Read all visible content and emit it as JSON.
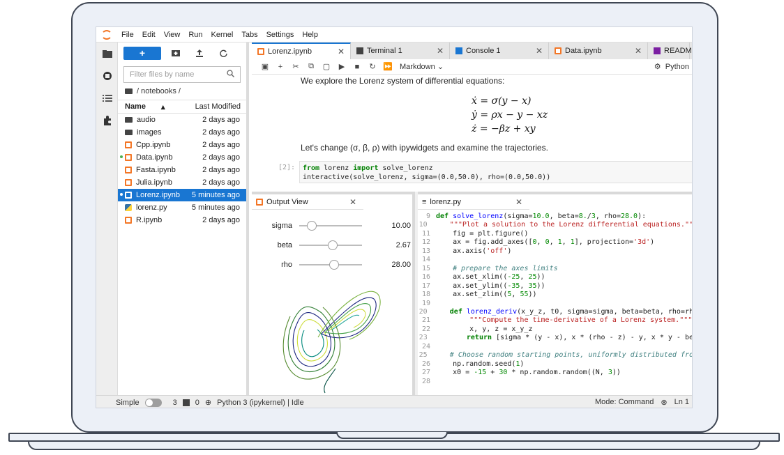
{
  "menu": [
    "File",
    "Edit",
    "View",
    "Run",
    "Kernel",
    "Tabs",
    "Settings",
    "Help"
  ],
  "filebrowser": {
    "search_placeholder": "Filter files by name",
    "breadcrumb": "/ notebooks /",
    "col_name": "Name",
    "col_modified": "Last Modified",
    "files": [
      {
        "name": "audio",
        "modified": "2 days ago"
      },
      {
        "name": "images",
        "modified": "2 days ago"
      },
      {
        "name": "Cpp.ipynb",
        "modified": "2 days ago"
      },
      {
        "name": "Data.ipynb",
        "modified": "2 days ago"
      },
      {
        "name": "Fasta.ipynb",
        "modified": "2 days ago"
      },
      {
        "name": "Julia.ipynb",
        "modified": "2 days ago"
      },
      {
        "name": "Lorenz.ipynb",
        "modified": "5 minutes ago"
      },
      {
        "name": "lorenz.py",
        "modified": "5 minutes ago"
      },
      {
        "name": "R.ipynb",
        "modified": "2 days ago"
      }
    ]
  },
  "tabs": [
    "Lorenz.ipynb",
    "Terminal 1",
    "Console 1",
    "Data.ipynb",
    "README"
  ],
  "nb_toolbar": {
    "celltype": "Markdown",
    "kernel": "Python"
  },
  "notebook": {
    "intro": "We explore the Lorenz system of differential equations:",
    "eq1": "ẋ = σ(y − x)",
    "eq2": "ẏ = ρx − y − xz",
    "eq3": "ż = −βz + xy",
    "change": "Let's change (σ, β, ρ) with ipywidgets and examine the trajectories.",
    "prompt": "[2]:",
    "code1_kw1": "from",
    "code1_mid": " lorenz ",
    "code1_kw2": "import",
    "code1_end": " solve_lorenz",
    "code2": "interactive(solve_lorenz, sigma=(0.0,50.0), rho=(0.0,50.0))"
  },
  "output_view": {
    "title": "Output View",
    "sliders": [
      {
        "label": "sigma",
        "value": "10.00",
        "fraction": 0.2
      },
      {
        "label": "beta",
        "value": "2.67",
        "fraction": 0.53
      },
      {
        "label": "rho",
        "value": "28.00",
        "fraction": 0.56
      }
    ]
  },
  "editor": {
    "title": "lorenz.py",
    "lines": [
      {
        "n": "9",
        "html": "<span class='kwb'>def</span> <span class='fn'>solve_lorenz</span>(sigma=<span class='nm'>10.0</span>, beta=<span class='nm'>8.</span>/<span class='nm'>3</span>, rho=<span class='nm'>28.0</span>):"
      },
      {
        "n": "10",
        "html": "    <span class='str'>\"\"\"Plot a solution to the Lorenz differential equations.\"\"</span>"
      },
      {
        "n": "11",
        "html": "    fig = plt.figure()"
      },
      {
        "n": "12",
        "html": "    ax = fig.add_axes([<span class='nm'>0</span>, <span class='nm'>0</span>, <span class='nm'>1</span>, <span class='nm'>1</span>], projection=<span class='str'>'3d'</span>)"
      },
      {
        "n": "13",
        "html": "    ax.axis(<span class='str'>'off'</span>)"
      },
      {
        "n": "14",
        "html": ""
      },
      {
        "n": "15",
        "html": "    <span class='cmt'># prepare the axes limits</span>"
      },
      {
        "n": "16",
        "html": "    ax.set_xlim((<span class='nm'>-25</span>, <span class='nm'>25</span>))"
      },
      {
        "n": "17",
        "html": "    ax.set_ylim((<span class='nm'>-35</span>, <span class='nm'>35</span>))"
      },
      {
        "n": "18",
        "html": "    ax.set_zlim((<span class='nm'>5</span>, <span class='nm'>55</span>))"
      },
      {
        "n": "19",
        "html": ""
      },
      {
        "n": "20",
        "html": "    <span class='kwb'>def</span> <span class='fn'>lorenz_deriv</span>(x_y_z, t0, sigma=sigma, beta=beta, rho=rh"
      },
      {
        "n": "21",
        "html": "        <span class='str'>\"\"\"Compute the time-derivative of a Lorenz system.\"\"\"</span>"
      },
      {
        "n": "22",
        "html": "        x, y, z = x_y_z"
      },
      {
        "n": "23",
        "html": "        <span class='kwb'>return</span> [sigma * (y - x), x * (rho - z) - y, x * y - be"
      },
      {
        "n": "24",
        "html": ""
      },
      {
        "n": "25",
        "html": "    <span class='cmt'># Choose random starting points, uniformly distributed fro</span>"
      },
      {
        "n": "26",
        "html": "    np.random.seed(<span class='nm'>1</span>)"
      },
      {
        "n": "27",
        "html": "    x0 = <span class='nm'>-15</span> + <span class='nm'>30</span> * np.random.random((N, <span class='nm'>3</span>))"
      },
      {
        "n": "28",
        "html": ""
      }
    ]
  },
  "status": {
    "simple": "Simple",
    "count1": "3",
    "count2": "0",
    "kernel": "Python 3 (ipykernel) | Idle",
    "mode": "Mode: Command",
    "ln": "Ln 1"
  }
}
